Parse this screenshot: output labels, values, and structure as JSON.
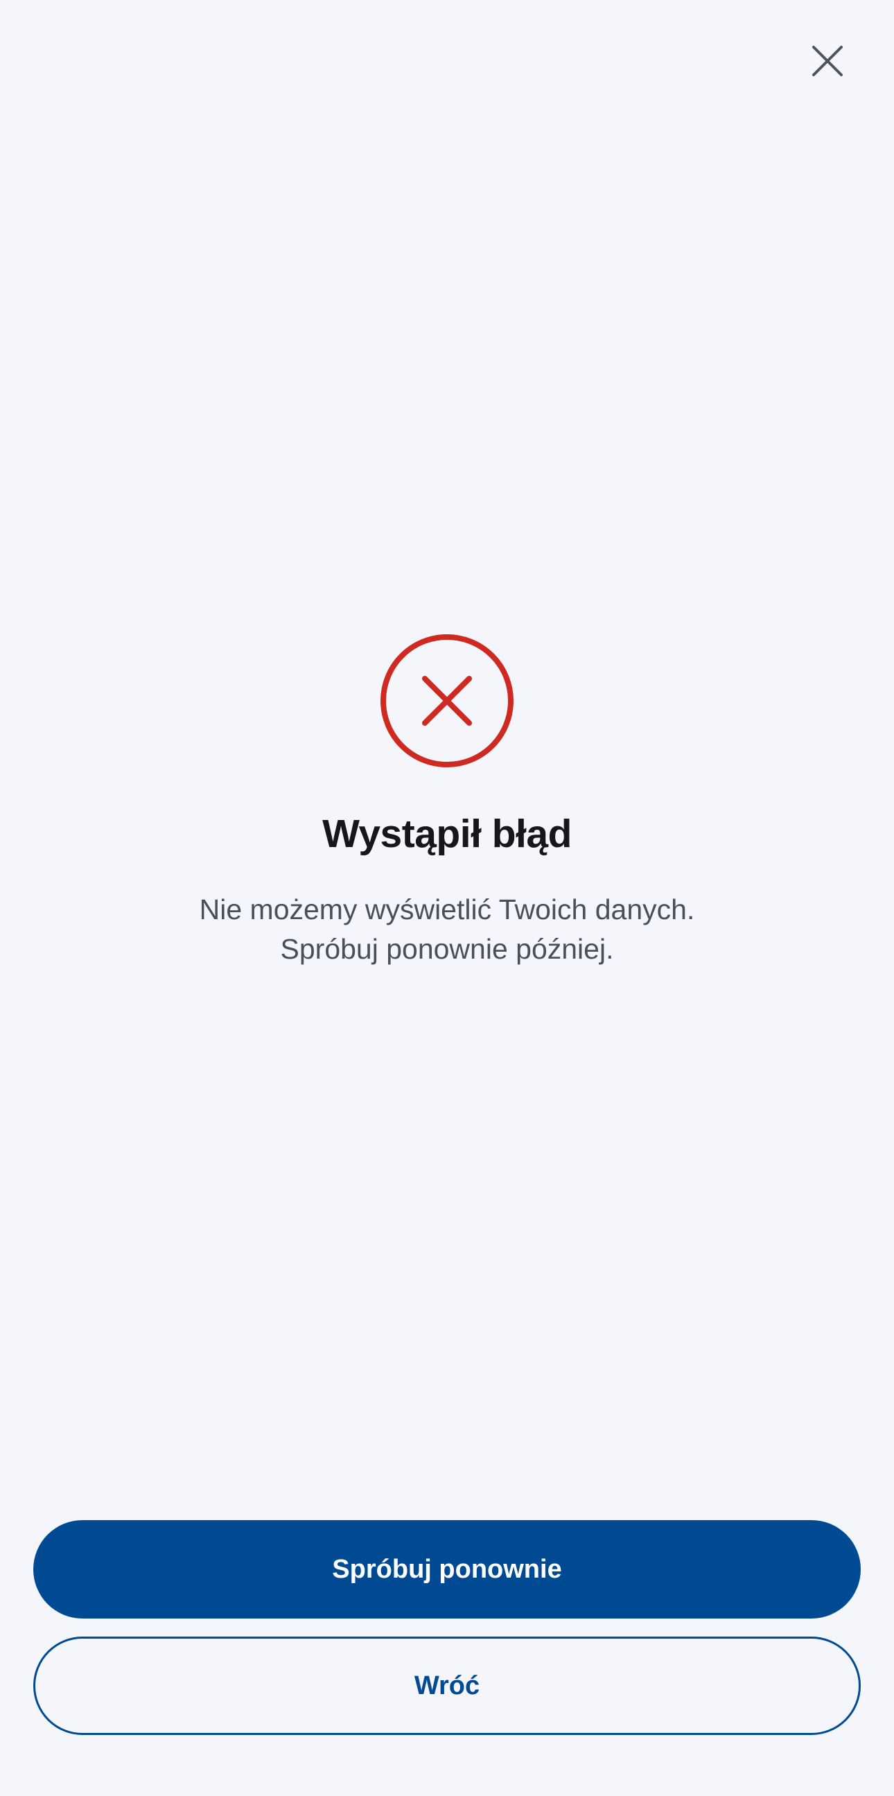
{
  "header": {
    "close_icon": "close-icon"
  },
  "error": {
    "icon": "error-circle-x-icon",
    "title": "Wystąpił błąd",
    "message_line1": "Nie możemy wyświetlić Twoich danych.",
    "message_line2": "Spróbuj ponownie później."
  },
  "actions": {
    "retry_label": "Spróbuj ponownie",
    "back_label": "Wróć"
  },
  "colors": {
    "background": "#f5f6fb",
    "primary": "#004a94",
    "error": "#cf2a22",
    "title_text": "#15171c",
    "body_text": "#4a5057",
    "icon_gray": "#4e5359"
  }
}
